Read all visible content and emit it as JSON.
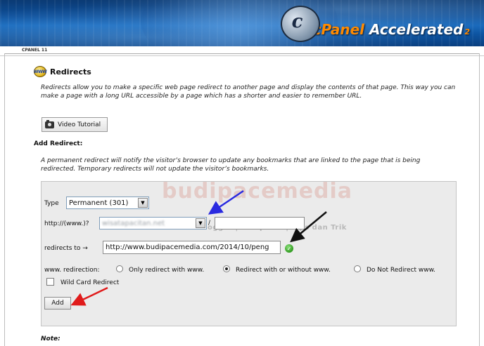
{
  "header": {
    "brand_main": "cPanel",
    "brand_accent": "Accelerated",
    "brand_sub": "2",
    "breadcrumb": "CPANEL 11"
  },
  "page": {
    "title": "Redirects",
    "description": "Redirects allow you to make a specific web page redirect to another page and display the contents of that page. This way you can make a page with a long URL accessible by a page which has a shorter and easier to remember URL.",
    "video_button": "Video Tutorial",
    "add_heading": "Add Redirect:",
    "add_description": "A permanent redirect will notify the visitor’s browser to update any bookmarks that are linked to the page that is being redirected. Temporary redirects will not update the visitor’s bookmarks.",
    "note_label": "Note:"
  },
  "form": {
    "type_label": "Type",
    "type_value": "Permanent (301)",
    "http_label": "http://(www.)?",
    "domain_value": "wisatapacitan.net",
    "slash": "/",
    "path_value": "",
    "redirects_to_label": "redirects to →",
    "redirects_to_value": "http://www.budipacemedia.com/2014/10/peng",
    "www_label": "www. redirection:",
    "radio_only_www": "Only redirect with www.",
    "radio_with_without": "Redirect with or without www.",
    "radio_no_www": "Do Not Redirect www.",
    "selected_redirection": "Redirect with or without www.",
    "wildcard_label": "Wild Card Redirect",
    "wildcard_checked": false,
    "add_button": "Add"
  },
  "watermark": {
    "main": "budipacemedia",
    "sub": "Tutorial Blogger | Komputer | Tips dan Trik"
  },
  "colors": {
    "banner": "#0d4f9a",
    "accent_orange": "#ff8a00",
    "panel_bg": "#ebebeb",
    "arrow_blue": "#2a2ae0",
    "arrow_black": "#111111",
    "arrow_red": "#e01b1b"
  }
}
